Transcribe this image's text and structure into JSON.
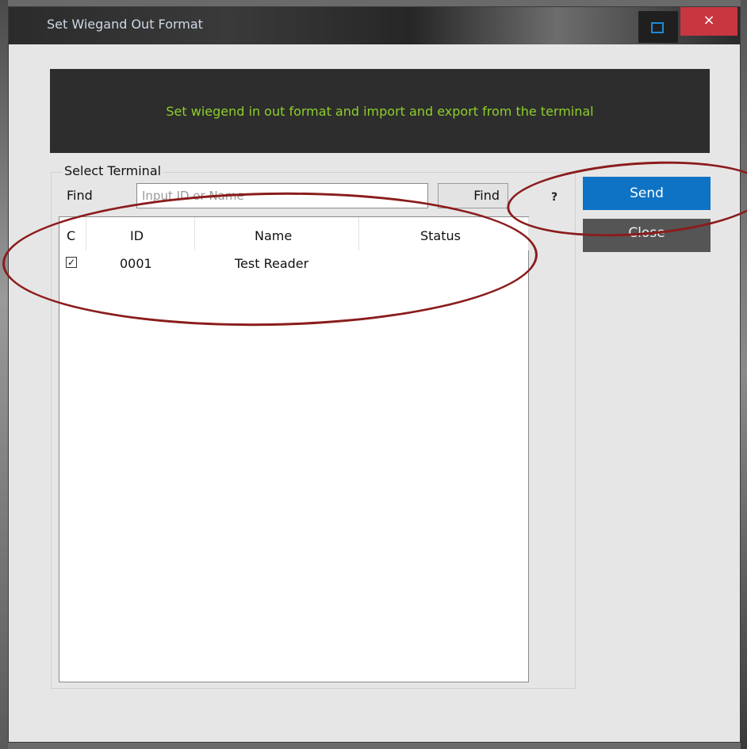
{
  "window": {
    "title": "Set Wiegand Out Format",
    "close_glyph": "×"
  },
  "banner": {
    "text": "Set wiegend in  out format and import and export from the terminal",
    "text_color": "#8dcf2b"
  },
  "terminal_group": {
    "label": "Select Terminal",
    "find_label": "Find",
    "search_placeholder": "Input ID or Name",
    "search_value": "",
    "find_button": "Find",
    "help_glyph": "?"
  },
  "table": {
    "columns": [
      "C",
      "ID",
      "Name",
      "Status"
    ],
    "rows": [
      {
        "checked": true,
        "check_glyph": "✓",
        "id": "0001",
        "name": "Test Reader",
        "status": ""
      }
    ]
  },
  "actions": {
    "send_label": "Send",
    "close_label": "Close"
  },
  "colors": {
    "send_accent": "#0f73c5",
    "annotation": "#8b1c1c",
    "title_close": "#c8373f"
  }
}
